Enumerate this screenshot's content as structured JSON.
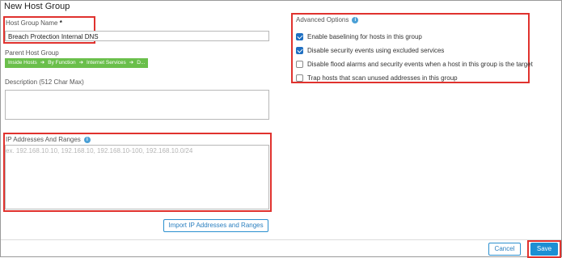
{
  "dialog": {
    "title": "New Host Group"
  },
  "host_group_name": {
    "label": "Host Group Name",
    "required_mark": "*",
    "value": "Breach Protection Internal DNS"
  },
  "parent_host_group": {
    "label": "Parent Host Group",
    "path": [
      "Inside Hosts",
      "By Function",
      "Internet Services",
      "D..."
    ],
    "separator": "➔",
    "tag_color": "#6abf4b"
  },
  "description": {
    "label": "Description (512 Char Max)",
    "value": ""
  },
  "ip_ranges": {
    "label": "IP Addresses And Ranges",
    "placeholder": "ex. 192.168.10.10, 192.168.10, 192.168.10-100, 192.168.10.0/24",
    "import_button": "Import IP Addresses and Ranges"
  },
  "advanced": {
    "label": "Advanced Options",
    "options": [
      {
        "label": "Enable baselining for hosts in this group",
        "checked": true
      },
      {
        "label": "Disable security events using excluded services",
        "checked": true
      },
      {
        "label": "Disable flood alarms and security events when a host in this group is the target",
        "checked": false
      },
      {
        "label": "Trap hosts that scan unused addresses in this group",
        "checked": false
      }
    ]
  },
  "footer": {
    "cancel": "Cancel",
    "save": "Save"
  },
  "colors": {
    "highlight": "#e0322e",
    "primary": "#1d8fd3",
    "info": "#4aa0d6",
    "checkbox": "#1e6fc2"
  }
}
